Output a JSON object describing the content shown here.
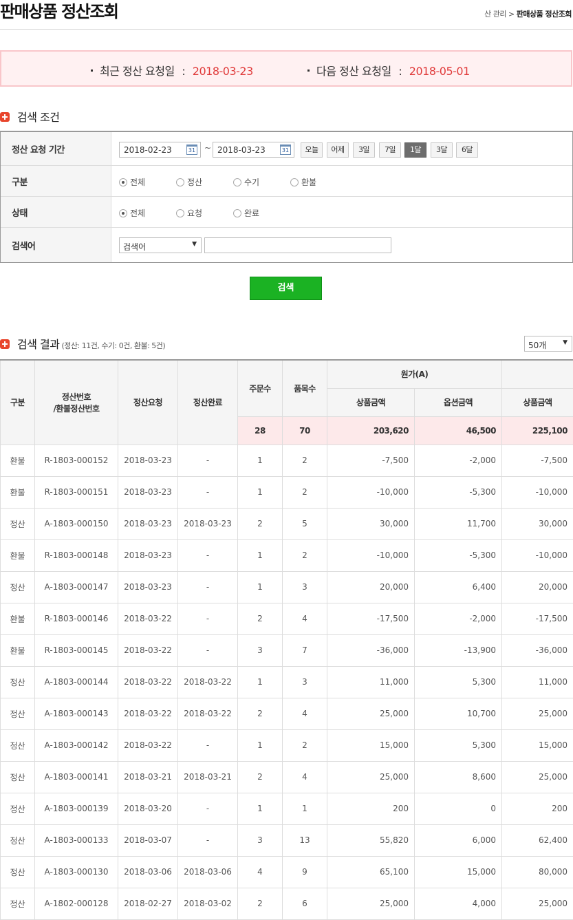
{
  "header": {
    "title": "판매상품 정산조회",
    "breadcrumb_prev": "산 관리",
    "breadcrumb_sep": ">",
    "breadcrumb_current": "판매상품 정산조회"
  },
  "notice": {
    "last_label": "최근 정산 요청일",
    "last_value": "2018-03-23",
    "next_label": "다음 정산 요청일",
    "next_value": "2018-05-01",
    "colon": ":"
  },
  "search": {
    "section_title": "검색 조건",
    "period_label": "정산 요청 기간",
    "date_from": "2018-02-23",
    "date_to": "2018-03-23",
    "calendar_text": "31",
    "tilde": "~",
    "period_buttons": [
      "오늘",
      "어제",
      "3일",
      "7일",
      "1달",
      "3달",
      "6달"
    ],
    "period_active": "1달",
    "type_label": "구분",
    "type_options": [
      "전체",
      "정산",
      "수기",
      "환불"
    ],
    "type_selected": "전체",
    "status_label": "상태",
    "status_options": [
      "전체",
      "요청",
      "완료"
    ],
    "status_selected": "전체",
    "keyword_label": "검색어",
    "keyword_select": "검색어",
    "keyword_value": "",
    "submit": "검색"
  },
  "result": {
    "section_title": "검색 결과",
    "summary": "(정산: 11건, 수기: 0건, 환불: 5건)",
    "page_size": "50개",
    "columns": {
      "type": "구분",
      "number": "정산번호\n/환불정산번호",
      "requested": "정산요청",
      "completed": "정산완료",
      "orders": "주문수",
      "items": "품목수",
      "cost_group": "원가(A)",
      "product_amount": "상품금액",
      "option_amount": "옵션금액",
      "product_amount2": "상품금액"
    },
    "totals": {
      "orders": "28",
      "items": "70",
      "product_amount": "203,620",
      "option_amount": "46,500",
      "product_amount2": "225,100"
    },
    "rows": [
      [
        "환불",
        "R-1803-000152",
        "2018-03-23",
        "-",
        "1",
        "2",
        "-7,500",
        "-2,000",
        "-7,500"
      ],
      [
        "환불",
        "R-1803-000151",
        "2018-03-23",
        "-",
        "1",
        "2",
        "-10,000",
        "-5,300",
        "-10,000"
      ],
      [
        "정산",
        "A-1803-000150",
        "2018-03-23",
        "2018-03-23",
        "2",
        "5",
        "30,000",
        "11,700",
        "30,000"
      ],
      [
        "환불",
        "R-1803-000148",
        "2018-03-23",
        "-",
        "1",
        "2",
        "-10,000",
        "-5,300",
        "-10,000"
      ],
      [
        "정산",
        "A-1803-000147",
        "2018-03-23",
        "-",
        "1",
        "3",
        "20,000",
        "6,400",
        "20,000"
      ],
      [
        "환불",
        "R-1803-000146",
        "2018-03-22",
        "-",
        "2",
        "4",
        "-17,500",
        "-2,000",
        "-17,500"
      ],
      [
        "환불",
        "R-1803-000145",
        "2018-03-22",
        "-",
        "3",
        "7",
        "-36,000",
        "-13,900",
        "-36,000"
      ],
      [
        "정산",
        "A-1803-000144",
        "2018-03-22",
        "2018-03-22",
        "1",
        "3",
        "11,000",
        "5,300",
        "11,000"
      ],
      [
        "정산",
        "A-1803-000143",
        "2018-03-22",
        "2018-03-22",
        "2",
        "4",
        "25,000",
        "10,700",
        "25,000"
      ],
      [
        "정산",
        "A-1803-000142",
        "2018-03-22",
        "-",
        "1",
        "2",
        "15,000",
        "5,300",
        "15,000"
      ],
      [
        "정산",
        "A-1803-000141",
        "2018-03-21",
        "2018-03-21",
        "2",
        "4",
        "25,000",
        "8,600",
        "25,000"
      ],
      [
        "정산",
        "A-1803-000139",
        "2018-03-20",
        "-",
        "1",
        "1",
        "200",
        "0",
        "200"
      ],
      [
        "정산",
        "A-1803-000133",
        "2018-03-07",
        "-",
        "3",
        "13",
        "55,820",
        "6,000",
        "62,400"
      ],
      [
        "정산",
        "A-1803-000130",
        "2018-03-06",
        "2018-03-06",
        "4",
        "9",
        "65,100",
        "15,000",
        "80,000"
      ],
      [
        "정산",
        "A-1802-000128",
        "2018-02-27",
        "2018-03-02",
        "2",
        "6",
        "25,000",
        "4,000",
        "25,000"
      ]
    ]
  },
  "colors": {
    "accent_red": "#e03a3a",
    "search_green": "#1bb223",
    "notice_bg": "#fff1f2",
    "section_icon": "#e8452c"
  },
  "icons": {
    "section": "section-square-icon",
    "calendar": "calendar-icon",
    "dropdown": "dropdown-arrow-icon"
  }
}
